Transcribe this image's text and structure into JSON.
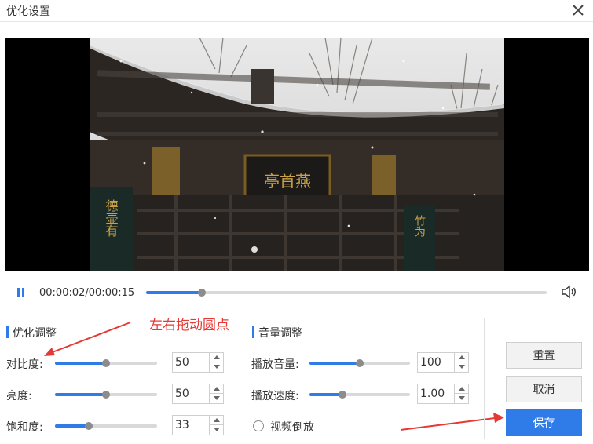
{
  "window": {
    "title": "优化设置"
  },
  "player": {
    "time": "00:00:02/00:00:15",
    "progress_fraction": 0.14,
    "board_text": "亭首燕",
    "pillar_left_text": "德壶有",
    "pillar_right_text": "竹为"
  },
  "optimize": {
    "title": "优化调整",
    "contrast": {
      "label": "对比度:",
      "value": "50",
      "fraction": 0.5
    },
    "brightness": {
      "label": "亮度:",
      "value": "50",
      "fraction": 0.5
    },
    "saturation": {
      "label": "饱和度:",
      "value": "33",
      "fraction": 0.33
    }
  },
  "volume_section": {
    "title": "音量调整",
    "play_volume": {
      "label": "播放音量:",
      "value": "100",
      "fraction": 0.5
    },
    "play_speed": {
      "label": "播放速度:",
      "value": "1.00",
      "fraction": 0.33
    },
    "reverse_label": "视频倒放",
    "reverse_checked": false
  },
  "buttons": {
    "reset": "重置",
    "cancel": "取消",
    "save": "保存"
  },
  "annotation": {
    "text": "左右拖动圆点"
  },
  "colors": {
    "accent": "#2f7be8",
    "annotation": "#e53935"
  }
}
